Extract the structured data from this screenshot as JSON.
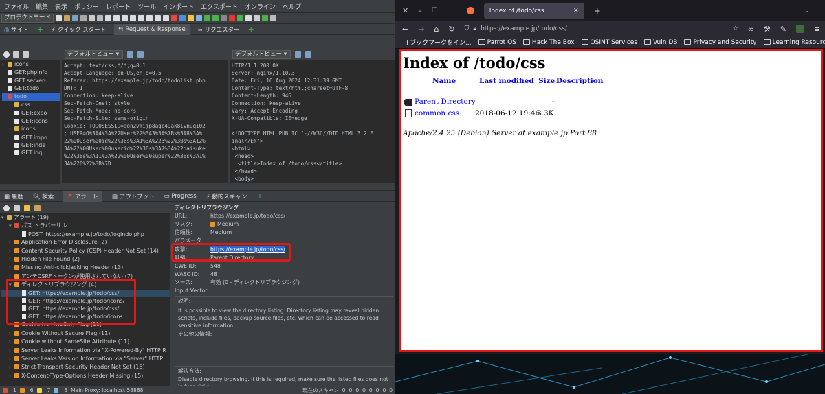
{
  "zap": {
    "menu": [
      "ファイル",
      "編集",
      "表示",
      "ポリシー",
      "レポート",
      "ツール",
      "インポート",
      "エクスポート",
      "オンライン",
      "ヘルプ"
    ],
    "mode": "プロテクトモード",
    "tabs": {
      "site": "サイト",
      "quickstart": "クイック スタート",
      "reqres": "Request & Response",
      "requester": "リクエスター"
    },
    "view_label_left": "デフォルトビュー",
    "view_label_right": "デフォルトビュー",
    "site_tree": [
      {
        "label": "icons",
        "type": "folder",
        "indent": 0
      },
      {
        "label": "GET:phpinfo",
        "type": "flag",
        "indent": 0
      },
      {
        "label": "GET:server-",
        "type": "flag",
        "indent": 0
      },
      {
        "label": "GET:todo",
        "type": "flag",
        "indent": 0
      },
      {
        "label": "todo",
        "type": "folderflag",
        "indent": 0
      },
      {
        "label": "css",
        "type": "folder",
        "indent": 1
      },
      {
        "label": "GET:expo",
        "type": "flag",
        "indent": 1
      },
      {
        "label": "GET:icons",
        "type": "flag",
        "indent": 1
      },
      {
        "label": "icons",
        "type": "folder",
        "indent": 1
      },
      {
        "label": "GET:impo",
        "type": "flag",
        "indent": 1
      },
      {
        "label": "GET:inde",
        "type": "flag",
        "indent": 1
      },
      {
        "label": "GET:inqu",
        "type": "flag",
        "indent": 1
      }
    ],
    "request_text": "Accept: text/css,*/*;q=0.1\nAccept-Language: en-US,en;q=0.5\nReferer: https://example.jp/todo/todolist.php\nDNT: 1\nConnection: keep-alive\nSec-Fetch-Dest: style\nSec-Fetch-Mode: no-cors\nSec-Fetch-Site: same-origin\nCookie: TODOSESSID=aon2vmijp8aqc49ak8lvnuqi02\n; USER=O%3A4%3A%22User%22%3A3%3A%7Bs%3A8%3A%\n22%00User%00id%22%3Bs%3A1%3A%223%22%3Bs%3A12%\n3A%22%00User%00userid%22%3Bs%3A7%3A%22daisuke\n%22%3Bs%3A11%3A%22%00User%00super%22%3Bs%3A1%\n3A%220%22%3B%7D",
    "response_text": "HTTP/1.1 200 OK\nServer: nginx/1.10.3\nDate: Fri, 16 Aug 2024 12:31:39 GMT\nContent-Type: text/html;charset=UTF-8\nContent-Length: 946\nConnection: keep-alive\nVary: Accept-Encoding\nX-UA-Compatible: IE=edge\n\n<!DOCTYPE HTML PUBLIC \"-//W3C//DTD HTML 3.2 F\ninal//EN\">\n<html>\n <head>\n  <title>Index of /todo/css</title>\n </head>\n <body>",
    "bottom_tabs": [
      "履歴",
      "検索",
      "アラート",
      "アウトプット",
      "Progress",
      "動的スキャン"
    ],
    "alerts_root": "アラート (19)",
    "alerts": [
      {
        "label": "パス トラバーサル",
        "indent": 1,
        "type": "flagr",
        "open": true
      },
      {
        "label": "POST: https://example.jp/todo/logindo.php",
        "indent": 2,
        "type": "doc"
      },
      {
        "label": "Application Error Disclosure (2)",
        "indent": 1,
        "type": "flag"
      },
      {
        "label": "Content Security Policy (CSP) Header Not Set (14)",
        "indent": 1,
        "type": "flag"
      },
      {
        "label": "Hidden File Found (2)",
        "indent": 1,
        "type": "flag"
      },
      {
        "label": "Missing Anti-clickjacking Header (13)",
        "indent": 1,
        "type": "flag"
      },
      {
        "label": "アンチCSRFトークンが使用されていない (7)",
        "indent": 1,
        "type": "flag"
      },
      {
        "label": "ディレクトリブラウジング (4)",
        "indent": 1,
        "type": "flag",
        "open": true
      },
      {
        "label": "GET: https://example.jp/todo/css/",
        "indent": 2,
        "type": "doc",
        "selected": true
      },
      {
        "label": "GET: https://example.jp/todo/icons/",
        "indent": 2,
        "type": "doc"
      },
      {
        "label": "GET: https://example.jp/todo/css/",
        "indent": 2,
        "type": "doc"
      },
      {
        "label": "GET: https://example.jp/todo/icons",
        "indent": 2,
        "type": "doc"
      },
      {
        "label": "Cookie No HttpOnly Flag (11)",
        "indent": 1,
        "type": "flag"
      },
      {
        "label": "Cookie Without Secure Flag (11)",
        "indent": 1,
        "type": "flag"
      },
      {
        "label": "Cookie without SameSite Attribute (11)",
        "indent": 1,
        "type": "flag"
      },
      {
        "label": "Server Leaks Information via \"X-Powered-By\" HTTP R",
        "indent": 1,
        "type": "flag"
      },
      {
        "label": "Server Leaks Version Information via \"Server\" HTTP",
        "indent": 1,
        "type": "flag"
      },
      {
        "label": "Strict-Transport-Security Header Not Set (16)",
        "indent": 1,
        "type": "flag"
      },
      {
        "label": "X-Content-Type-Options Header Missing (15)",
        "indent": 1,
        "type": "flag"
      }
    ],
    "detail": {
      "title": "ディレクトリブラウジング",
      "url_k": "URL:",
      "url": "https://example.jp/todo/css/",
      "risk_k": "リスク:",
      "risk": "Medium",
      "conf_k": "信頼性:",
      "conf": "Medium",
      "param_k": "パラメータ:",
      "attack_k": "攻撃:",
      "attack": "https://example.jp/todo/css/",
      "evidence_k": "証拠:",
      "evidence": "Parent Directory",
      "cwe_k": "CWE ID:",
      "cwe": "548",
      "wasc_k": "WASC ID:",
      "wasc": "48",
      "source_k": "ソース:",
      "source": "有効 (0 - ディレクトリブラウジング)",
      "vector_k": "Input Vector:",
      "desc_k": "説明:",
      "desc": "It is possible to view the directory listing.  Directory listing may reveal hidden scripts, include files, backup source files, etc. which can be accessed to read sensitive information.",
      "other_k": "その他の情報:",
      "sol_k": "解決方法:",
      "sol": "Disable directory browsing.  If this is required, make sure the listed files does not induce risks."
    },
    "status": {
      "c1": "1",
      "c2": "6",
      "c3": "7",
      "c4": "5",
      "proxy": "Main Proxy: localhost:58888",
      "scan": "現在のスキャン",
      "s1": "0",
      "s2": "0",
      "s3": "0",
      "s4": "0",
      "s5": "0",
      "s6": "0",
      "s7": "0",
      "s8": "0"
    }
  },
  "firefox": {
    "tab_title": "Index of /todo/css",
    "url": "https://example.jp/todo/css/",
    "bookmarks": [
      "ブックマークをイン...",
      "Parrot OS",
      "Hack The Box",
      "OSINT Services",
      "Vuln DB",
      "Privacy and Security",
      "Learning Resources"
    ],
    "page": {
      "heading": "Index of /todo/css",
      "cols": {
        "name": "Name",
        "modified": "Last modified",
        "size": "Size",
        "desc": "Description"
      },
      "parent": {
        "name": "Parent Directory",
        "size": "-"
      },
      "file": {
        "name": "common.css",
        "modified": "2018-06-12 19:46",
        "size": "3.3K"
      },
      "footer": "Apache/2.4.25 (Debian) Server at example.jp Port 88"
    }
  }
}
